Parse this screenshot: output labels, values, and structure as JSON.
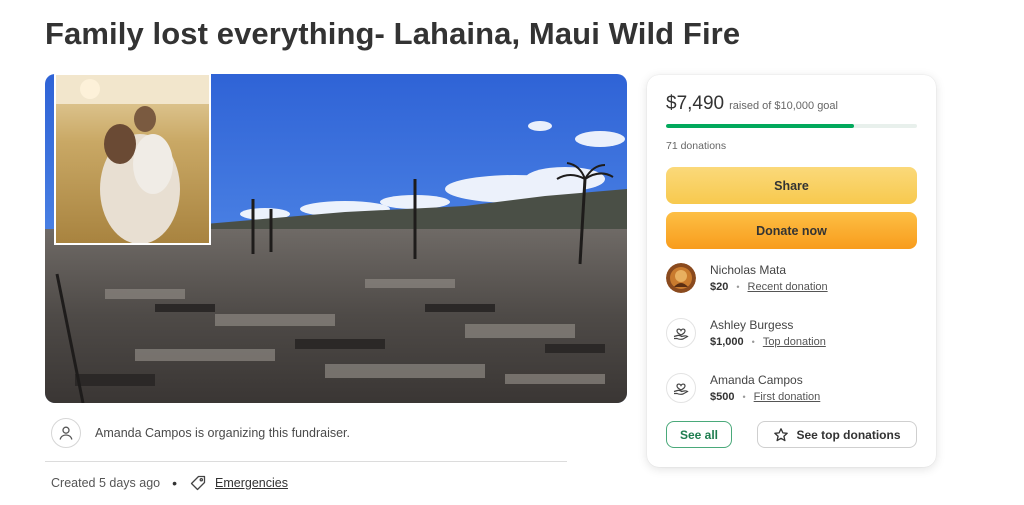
{
  "page": {
    "title": "Family lost everything- Lahaina, Maui Wild Fire"
  },
  "hero": {
    "image_alt": "Burned ruins of a neighborhood under a blue sky, with an inset photo of a mother hugging her child in a field"
  },
  "organizer": {
    "text": "Amanda Campos is organizing this fundraiser.",
    "icon": "person-icon"
  },
  "meta": {
    "created": "Created 5 days ago",
    "separator": "•",
    "category": "Emergencies",
    "category_icon": "tag-icon"
  },
  "donation_card": {
    "raised_amount": "$7,490",
    "goal_text": "raised of $10,000 goal",
    "progress_fraction": 0.749,
    "donation_count": "71 donations",
    "share_label": "Share",
    "donate_label": "Donate now",
    "donors": [
      {
        "name": "Nicholas Mata",
        "amount": "$20",
        "type": "Recent donation",
        "avatar": "photo"
      },
      {
        "name": "Ashley Burgess",
        "amount": "$1,000",
        "type": "Top donation",
        "avatar": "donation-heart-icon"
      },
      {
        "name": "Amanda Campos",
        "amount": "$500",
        "type": "First donation",
        "avatar": "donation-heart-icon"
      }
    ],
    "donor_separator": "•",
    "see_all_label": "See all",
    "see_top_label": "See top donations"
  },
  "colors": {
    "progress_green": "#02a95c",
    "share_yellow": "#f7c94e",
    "donate_orange": "#f89c1c",
    "see_all_green": "#1e7d4f"
  }
}
